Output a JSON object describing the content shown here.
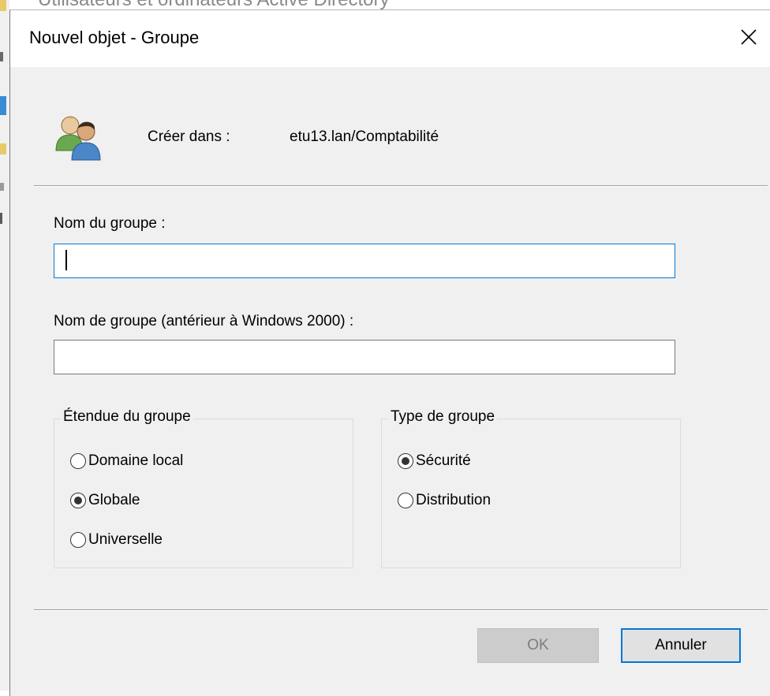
{
  "background_window": {
    "title": "Utilisateurs et ordinateurs Active Directory"
  },
  "dialog": {
    "title": "Nouvel objet - Groupe",
    "close_icon": "close-icon",
    "header": {
      "icon": "group-users-icon",
      "create_in_label": "Créer dans :",
      "create_in_value": "etu13.lan/Comptabilité"
    },
    "group_name": {
      "label": "Nom du groupe :",
      "value": "",
      "focused": true
    },
    "group_name_pre2000": {
      "label": "Nom de groupe (antérieur à Windows 2000) :",
      "value": ""
    },
    "scope": {
      "legend": "Étendue du groupe",
      "options": [
        {
          "label": "Domaine local",
          "checked": false
        },
        {
          "label": "Globale",
          "checked": true
        },
        {
          "label": "Universelle",
          "checked": false
        }
      ]
    },
    "type": {
      "legend": "Type de groupe",
      "options": [
        {
          "label": "Sécurité",
          "checked": true
        },
        {
          "label": "Distribution",
          "checked": false
        }
      ]
    },
    "buttons": {
      "ok": {
        "label": "OK",
        "enabled": false
      },
      "cancel": {
        "label": "Annuler",
        "enabled": true,
        "default": true
      }
    },
    "colors": {
      "accent": "#0078d7",
      "dialog_bg": "#f0f0f0",
      "disabled_button": "#cccccc"
    }
  }
}
